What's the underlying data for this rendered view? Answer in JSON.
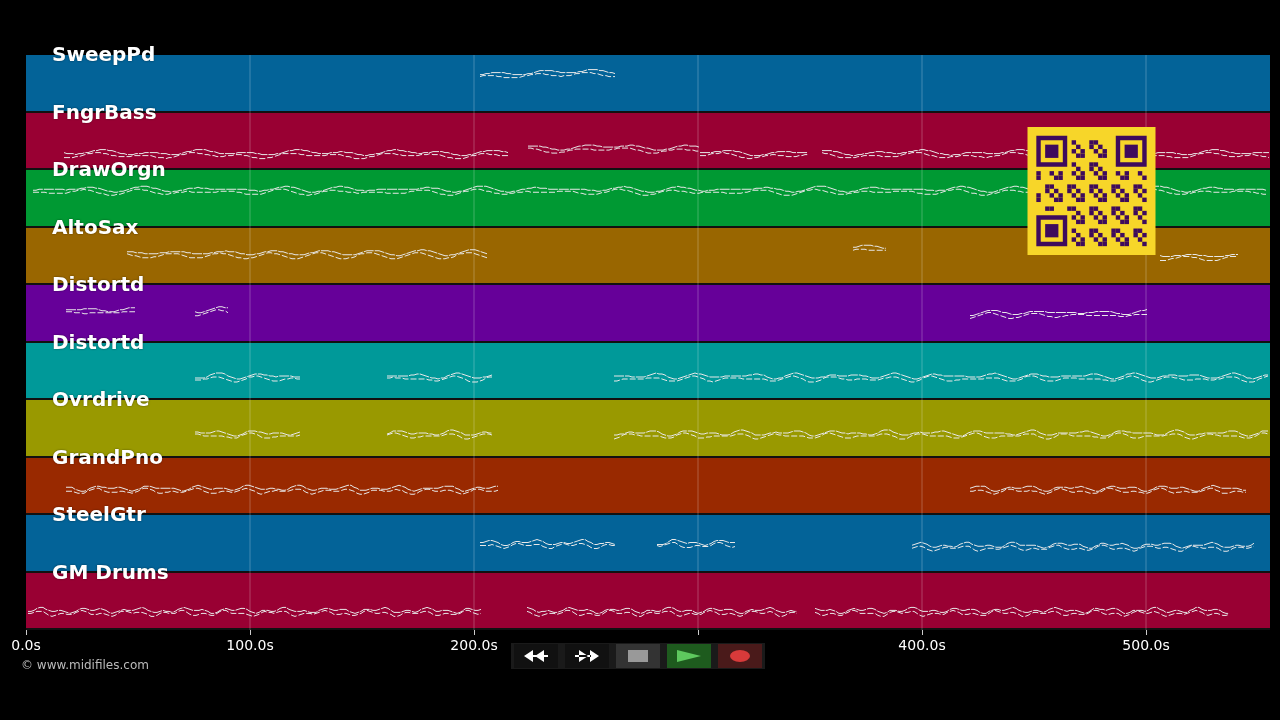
{
  "tracks": [
    {
      "name": "SweepPd",
      "color": "#036398"
    },
    {
      "name": "FngrBass",
      "color": "#990033"
    },
    {
      "name": "DrawOrgn",
      "color": "#009933"
    },
    {
      "name": "AltoSax",
      "color": "#996600"
    },
    {
      "name": "Distortd",
      "color": "#660099"
    },
    {
      "name": "Distortd",
      "color": "#009999"
    },
    {
      "name": "Ovrdrive",
      "color": "#999900"
    },
    {
      "name": "GrandPno",
      "color": "#992900"
    },
    {
      "name": "SteelGtr",
      "color": "#036398"
    },
    {
      "name": "GM Drums",
      "color": "#990033"
    }
  ],
  "time_axis": {
    "ticks": [
      {
        "kind": "labeled",
        "label": "0.0s"
      },
      {
        "kind": "labeled",
        "label": "100.0s"
      },
      {
        "kind": "labeled",
        "label": "200.0s"
      },
      {
        "kind": "unlabeled"
      },
      {
        "kind": "labeled",
        "label": "400.0s"
      },
      {
        "kind": "labeled",
        "label": "500.0s"
      }
    ]
  },
  "copyright": "© www.midifiles.com",
  "transport": [
    {
      "kind": "rewind"
    },
    {
      "kind": "forward"
    },
    {
      "kind": "stop"
    },
    {
      "kind": "play"
    },
    {
      "kind": "record"
    }
  ]
}
